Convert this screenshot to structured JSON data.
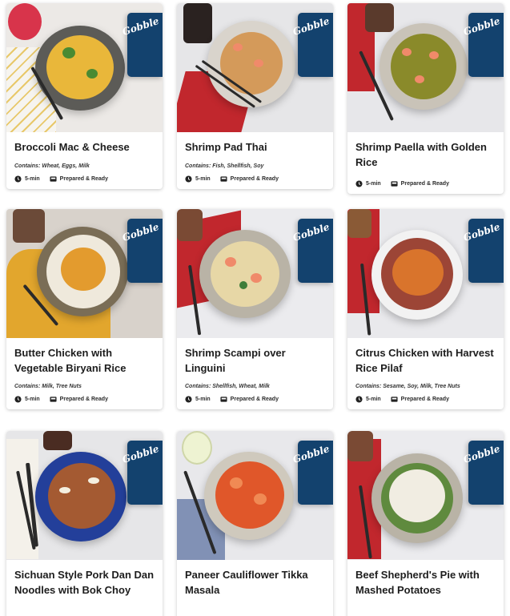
{
  "brand": {
    "logo_text": "Gobble",
    "accent": "#13426e"
  },
  "meta_icons": {
    "time": "clock-icon",
    "prepared": "tray-icon"
  },
  "cards": [
    {
      "title": "Broccoli Mac & Cheese",
      "contains": "Contains: Wheat, Eggs, Milk",
      "time": "5-min",
      "prep": "Prepared & Ready",
      "scene": {
        "bg": "#ece9e6",
        "plate": "#5c5b57",
        "food": "#e9b73a",
        "accent": "#4a8a32"
      }
    },
    {
      "title": "Shrimp Pad Thai",
      "contains": "Contains: Fish, Shellfish, Soy",
      "time": "5-min",
      "prep": "Prepared & Ready",
      "scene": {
        "bg": "#e6e6e8",
        "plate": "#d9d4cc",
        "food": "#d49a5a",
        "accent": "#c1272d"
      }
    },
    {
      "title": "Shrimp Paella with Golden Rice",
      "contains": "",
      "time": "5-min",
      "prep": "Prepared & Ready",
      "scene": {
        "bg": "#e7e7ea",
        "plate": "#c9c3b8",
        "food": "#8a8a2a",
        "accent": "#c1272d"
      }
    },
    {
      "title": "Butter Chicken with Vegetable Biryani Rice",
      "contains": "Contains: Milk, Tree Nuts",
      "time": "5-min",
      "prep": "Prepared & Ready",
      "scene": {
        "bg": "#d8d2cb",
        "plate": "#7a6d56",
        "food": "#e39b2e",
        "accent": "#e2a62d"
      }
    },
    {
      "title": "Shrimp Scampi over Linguini",
      "contains": "Contains: Shellfish, Wheat, Milk",
      "time": "5-min",
      "prep": "Prepared & Ready",
      "scene": {
        "bg": "#ebebee",
        "plate": "#b9b3a6",
        "food": "#e7d7a6",
        "accent": "#c1272d"
      }
    },
    {
      "title": "Citrus Chicken with Harvest Rice Pilaf",
      "contains": "Contains: Sesame, Soy, Milk, Tree Nuts",
      "time": "5-min",
      "prep": "Prepared & Ready",
      "scene": {
        "bg": "#e9e9ec",
        "plate": "#f2f2f2",
        "food": "#d9742c",
        "accent": "#c1272d"
      }
    },
    {
      "title": "Sichuan Style Pork Dan Dan Noodles with Bok Choy",
      "contains": "",
      "time": "",
      "prep": "",
      "scene": {
        "bg": "#e6e6e8",
        "plate": "#233f9a",
        "food": "#a45a32",
        "accent": "#ffffff"
      }
    },
    {
      "title": "Paneer Cauliflower Tikka Masala",
      "contains": "",
      "time": "",
      "prep": "",
      "scene": {
        "bg": "#e8e8eb",
        "plate": "#cfc9bd",
        "food": "#e0572a",
        "accent": "#8191b5"
      }
    },
    {
      "title": "Beef Shepherd's Pie with Mashed Potatoes",
      "contains": "",
      "time": "",
      "prep": "",
      "scene": {
        "bg": "#ebebee",
        "plate": "#b9b3a6",
        "food": "#f1ede2",
        "accent": "#c1272d"
      }
    }
  ]
}
